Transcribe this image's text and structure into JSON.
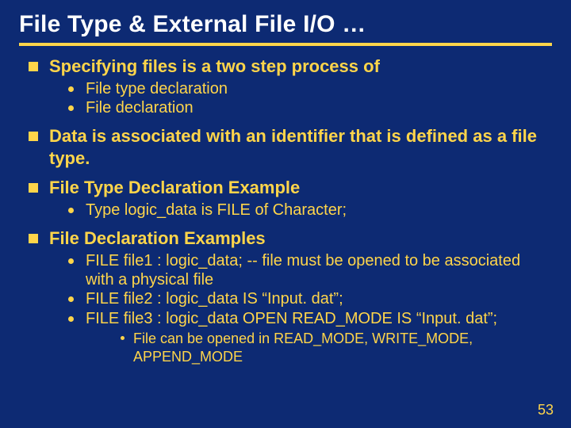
{
  "title": "File Type & External File I/O …",
  "page_number": "53",
  "bullets": [
    {
      "text": "Specifying files is a two step process of",
      "subs": [
        {
          "text": "File type declaration"
        },
        {
          "text": "File declaration"
        }
      ]
    },
    {
      "text": "Data is associated with an identifier that is defined as a file type."
    },
    {
      "text": "File Type Declaration Example",
      "subs": [
        {
          "text": "Type logic_data is FILE of Character;"
        }
      ]
    },
    {
      "text": "File Declaration Examples",
      "subs": [
        {
          "text": "FILE file1 : logic_data; -- file must be opened to be associated with a physical file"
        },
        {
          "text": "FILE file2 : logic_data IS “Input. dat”;"
        },
        {
          "text": "FILE file3 : logic_data OPEN READ_MODE IS “Input. dat”;",
          "subsubs": [
            {
              "text": "File can be opened in READ_MODE, WRITE_MODE, APPEND_MODE"
            }
          ]
        }
      ]
    }
  ]
}
